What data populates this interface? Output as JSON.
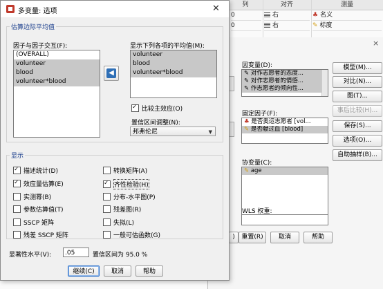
{
  "bg": {
    "headers": [
      "列",
      "对齐",
      "测量"
    ],
    "rows": [
      {
        "col": "0",
        "align": "右",
        "measure": "名义"
      },
      {
        "col": "0",
        "align": "右",
        "measure": "标度"
      }
    ]
  },
  "rdialog": {
    "dep_label": "因变量(D):",
    "dep_items": [
      "对作志愿者的态度...",
      "对作志愿者的情感...",
      "作志愿者的倾向性..."
    ],
    "fixed_label": "固定因子(F):",
    "fixed_items": [
      "是否奥运志愿者 [vol...",
      "是否献过血 [blood]"
    ],
    "cov_label": "协变量(C):",
    "cov_items": [
      "age"
    ],
    "wls_label": "WLS 权重:",
    "buttons": [
      "模型(M)...",
      "对比(N)...",
      "图(T)...",
      "事后比较(H)...",
      "保存(S)...",
      "选项(O)...",
      "自助抽样(B)..."
    ],
    "bottom_buttons": [
      "重置(R)",
      "取消",
      "帮助"
    ]
  },
  "dialog": {
    "title": "多变量: 选项",
    "est_group": "估算边际平均值",
    "factor_label": "因子与因子交互(F):",
    "factor_items": [
      "(OVERALL)",
      "volunteer",
      "blood",
      "volunteer*blood"
    ],
    "display_means_label": "显示下列各项的平均值(M):",
    "display_means_items": [
      "volunteer",
      "blood",
      "volunteer*blood"
    ],
    "compare_main": "比较主效应(O)",
    "ci_adjust_label": "置信区间调整(N):",
    "ci_adjust_value": "邦弗伦尼",
    "display_group": "显示",
    "checks_left": [
      {
        "label": "描述统计(D)",
        "checked": true
      },
      {
        "label": "效应量估算(E)",
        "checked": true
      },
      {
        "label": "实测幂(B)",
        "checked": false
      },
      {
        "label": "参数估算值(T)",
        "checked": false
      },
      {
        "label": "SSCP 矩阵",
        "checked": false
      },
      {
        "label": "残差 SSCP 矩阵",
        "checked": false
      }
    ],
    "checks_right": [
      {
        "label": "转换矩阵(A)",
        "checked": false
      },
      {
        "label": "齐性检验(H)",
        "checked": true
      },
      {
        "label": "分布-水平图(P)",
        "checked": false
      },
      {
        "label": "残差图(R)",
        "checked": false
      },
      {
        "label": "失拟(L)",
        "checked": false
      },
      {
        "label": "一般可估函数(G)",
        "checked": false
      }
    ],
    "sig_label": "显著性水平(V):",
    "sig_value": ".05",
    "ci_text": "置信区间为 95.0 %",
    "buttons": {
      "continue": "继续(C)",
      "cancel": "取消",
      "help": "帮助"
    }
  }
}
